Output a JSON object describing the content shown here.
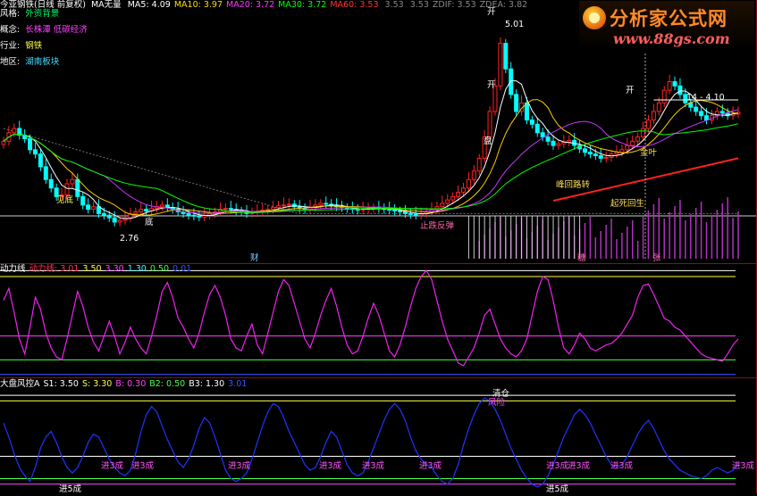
{
  "header": {
    "title": "今亚钢铁(日线 前复权)",
    "ma_mode": "MA无量",
    "ma": [
      {
        "label": "MA5:",
        "value": "4.09",
        "color": "#ffffff"
      },
      {
        "label": "MA10:",
        "value": "3.97",
        "color": "#ffdd00"
      },
      {
        "label": "MA20:",
        "value": "3.72",
        "color": "#ff33ff"
      },
      {
        "label": "MA30:",
        "value": "3.72",
        "color": "#00ff00"
      },
      {
        "label": "MA60:",
        "value": "3.53",
        "color": "#ff3333"
      },
      {
        "label": "",
        "value": "3.53",
        "color": "#888888"
      },
      {
        "label": "",
        "value": "3.53",
        "color": "#888888"
      },
      {
        "label": "ZDIF:",
        "value": "3.53",
        "color": "#888888"
      },
      {
        "label": "ZDEA:",
        "value": "3.82",
        "color": "#888888"
      }
    ]
  },
  "info": [
    {
      "key": "风格:",
      "value": "外资背景",
      "color": "#00ff66"
    },
    {
      "key": "概念:",
      "value": "长株潭 低碳经济",
      "color": "#ff44ff"
    },
    {
      "key": "行业:",
      "value": "钢铁",
      "color": "#ffff44"
    },
    {
      "key": "地区:",
      "value": "湖南板块",
      "color": "#44ddff"
    }
  ],
  "logo": {
    "main": "分析家公式网",
    "url": "www.88gs.com"
  },
  "panes": [
    {
      "name": "动力线",
      "items": [
        {
          "label": "动力线:",
          "value": "3.01",
          "color": "#ff3355"
        },
        {
          "label": "",
          "value": "3.50",
          "color": "#ffff44"
        },
        {
          "label": "",
          "value": "3.30",
          "color": "#ff44ff"
        },
        {
          "label": "",
          "value": "1.30",
          "color": "#44ffff"
        },
        {
          "label": "",
          "value": "0.50",
          "color": "#44ff44"
        },
        {
          "label": "",
          "value": "0.01",
          "color": "#3355ff"
        }
      ]
    },
    {
      "name": "大盘风控A",
      "items": [
        {
          "label": "S1:",
          "value": "3.50",
          "color": "#ffffff"
        },
        {
          "label": "S:",
          "value": "3.30",
          "color": "#ffff44"
        },
        {
          "label": "B:",
          "value": "0.30",
          "color": "#ff44ff"
        },
        {
          "label": "B2:",
          "value": "0.50",
          "color": "#44ff44"
        },
        {
          "label": "B3:",
          "value": "1.30",
          "color": "#ffffff"
        },
        {
          "label": "",
          "value": "3.01",
          "color": "#3355ff"
        }
      ]
    }
  ],
  "annotations": {
    "high": "5.01",
    "low": "2.76",
    "range": "14 - 4.10",
    "kai1": "开",
    "kai2": "开",
    "kai3": "开",
    "signals": [
      "见底",
      "底",
      "止跌反弹",
      "峰回路转",
      "起死回生",
      "金叶",
      "盘"
    ],
    "events": [
      "财",
      "糖",
      "张"
    ],
    "qingcang": "清仓",
    "fengxian": "风险"
  },
  "warnings": [
    "进3成",
    "进3成",
    "进3成",
    "进3成",
    "进3成",
    "进3成",
    "进3成",
    "进3成",
    "进3成",
    "进3成"
  ],
  "entries": [
    "进5成",
    "进5成"
  ],
  "colors": {
    "up": "#ff2222",
    "down": "#00ffff",
    "ma_gold": "#ffcc00",
    "ma_purple": "#cc33ff",
    "vol": "#b030c0",
    "momentum": "#ee22ee",
    "risk": "#2233ff"
  },
  "chart_data": [
    {
      "type": "line",
      "title": "今亚钢铁(日线 前复权)",
      "x_count": 140,
      "series": [
        {
          "name": "收盘",
          "values": [
            3.75,
            3.85,
            3.9,
            3.82,
            3.78,
            3.65,
            3.6,
            3.45,
            3.3,
            3.2,
            3.1,
            3.12,
            3.25,
            3.3,
            3.1,
            3.0,
            2.95,
            2.98,
            2.9,
            2.88,
            2.85,
            2.8,
            2.82,
            2.85,
            2.9,
            2.92,
            2.95,
            2.93,
            2.96,
            2.98,
            3.0,
            2.97,
            2.95,
            2.92,
            2.9,
            2.88,
            2.87,
            2.86,
            2.88,
            2.9,
            2.92,
            2.95,
            2.96,
            2.95,
            2.93,
            2.92,
            2.9,
            2.91,
            2.92,
            2.94,
            2.95,
            2.97,
            2.99,
            3.0,
            3.01,
            2.98,
            2.96,
            2.95,
            2.97,
            3.0,
            3.02,
            3.01,
            2.99,
            2.98,
            2.97,
            2.96,
            2.95,
            2.94,
            2.95,
            2.96,
            2.97,
            2.96,
            2.95,
            2.94,
            2.93,
            2.92,
            2.9,
            2.89,
            2.88,
            2.9,
            2.92,
            2.95,
            2.98,
            3.02,
            3.06,
            3.1,
            3.15,
            3.2,
            3.3,
            3.4,
            3.55,
            3.8,
            4.1,
            4.4,
            4.9,
            4.6,
            4.3,
            4.1,
            4.2,
            4.0,
            3.95,
            3.85,
            3.8,
            3.75,
            3.7,
            3.72,
            3.74,
            3.76,
            3.7,
            3.66,
            3.62,
            3.6,
            3.58,
            3.55,
            3.56,
            3.6,
            3.62,
            3.65,
            3.7,
            3.75,
            3.8,
            3.9,
            4.0,
            4.1,
            4.2,
            4.35,
            4.45,
            4.4,
            4.3,
            4.2,
            4.15,
            4.1,
            4.05,
            4.0,
            4.05,
            4.1,
            4.08,
            4.05,
            4.07,
            4.09
          ]
        },
        {
          "name": "动力线",
          "values": [
            2.5,
            2.9,
            2.1,
            1.2,
            0.7,
            1.6,
            2.6,
            2.2,
            1.4,
            0.9,
            0.6,
            0.5,
            1.2,
            2.0,
            2.8,
            2.3,
            1.6,
            1.1,
            0.8,
            1.3,
            1.8,
            1.3,
            0.7,
            1.1,
            1.6,
            1.2,
            0.9,
            0.7,
            1.3,
            2.0,
            2.8,
            3.1,
            2.6,
            1.9,
            1.6,
            1.2,
            0.9,
            1.4,
            2.1,
            2.7,
            3.0,
            2.6,
            2.0,
            1.2,
            0.9,
            0.8,
            1.3,
            1.7,
            1.0,
            0.7,
            1.4,
            2.1,
            2.8,
            3.2,
            3.0,
            2.4,
            1.8,
            1.2,
            0.9,
            1.4,
            2.0,
            2.5,
            2.9,
            2.3,
            1.6,
            1.0,
            0.7,
            0.8,
            1.3,
            1.9,
            2.4,
            2.0,
            1.4,
            0.8,
            0.6,
            1.0,
            1.6,
            2.3,
            2.9,
            3.3,
            3.5,
            3.2,
            2.5,
            1.8,
            1.2,
            0.8,
            0.4,
            0.3,
            0.6,
            0.9,
            1.4,
            2.0,
            2.2,
            1.7,
            1.2,
            0.9,
            0.7,
            0.6,
            0.8,
            1.2,
            2.0,
            2.8,
            3.3,
            3.2,
            2.5,
            1.6,
            0.9,
            0.7,
            1.0,
            1.4,
            1.2,
            0.9,
            0.8,
            0.9,
            1.0,
            1.05,
            1.2,
            1.4,
            1.7,
            2.0,
            2.6,
            3.0,
            3.05,
            2.7,
            2.3,
            1.9,
            1.8,
            1.6,
            1.5,
            1.3,
            1.1,
            0.9,
            0.7,
            0.6,
            0.55,
            0.5,
            0.45,
            0.7,
            1.0,
            1.2
          ]
        },
        {
          "name": "大盘风控A",
          "values": [
            2.5,
            2.0,
            1.4,
            0.9,
            0.6,
            0.4,
            0.9,
            1.6,
            2.0,
            2.2,
            1.8,
            1.3,
            0.9,
            0.7,
            0.9,
            1.3,
            1.8,
            2.1,
            2.0,
            1.6,
            1.2,
            0.9,
            0.7,
            0.6,
            0.8,
            1.4,
            2.2,
            2.8,
            3.1,
            2.9,
            2.4,
            1.9,
            1.5,
            1.1,
            0.9,
            1.2,
            1.7,
            2.3,
            2.7,
            2.5,
            2.0,
            1.4,
            0.8,
            0.5,
            0.4,
            0.5,
            0.7,
            1.2,
            1.8,
            2.4,
            2.9,
            3.2,
            3.1,
            2.7,
            2.2,
            1.8,
            1.4,
            1.0,
            0.8,
            0.9,
            1.3,
            1.8,
            2.2,
            2.0,
            1.5,
            1.0,
            0.7,
            0.6,
            0.7,
            1.1,
            1.6,
            2.1,
            2.6,
            3.0,
            3.2,
            3.0,
            2.6,
            2.0,
            1.5,
            1.2,
            1.0,
            0.9,
            0.6,
            0.4,
            0.3,
            0.5,
            1.0,
            1.7,
            2.3,
            2.8,
            3.2,
            3.4,
            3.3,
            3.0,
            2.6,
            2.1,
            1.6,
            1.2,
            0.8,
            0.5,
            0.3,
            0.2,
            0.3,
            0.6,
            1.0,
            1.5,
            2.0,
            2.4,
            2.8,
            3.0,
            2.8,
            2.5,
            2.1,
            1.7,
            1.3,
            1.0,
            0.9,
            1.0,
            1.3,
            1.7,
            2.1,
            2.4,
            2.6,
            2.3,
            1.9,
            1.5,
            1.2,
            1.0,
            0.8,
            0.7,
            0.6,
            0.55,
            0.5,
            0.6,
            0.8,
            0.9,
            0.8,
            0.7,
            0.8,
            1.0
          ]
        }
      ],
      "levels_momentum": [
        3.5,
        3.3,
        1.3,
        0.5,
        0.01
      ],
      "levels_risk": [
        3.5,
        3.3,
        0.3,
        0.5,
        1.3
      ]
    }
  ]
}
